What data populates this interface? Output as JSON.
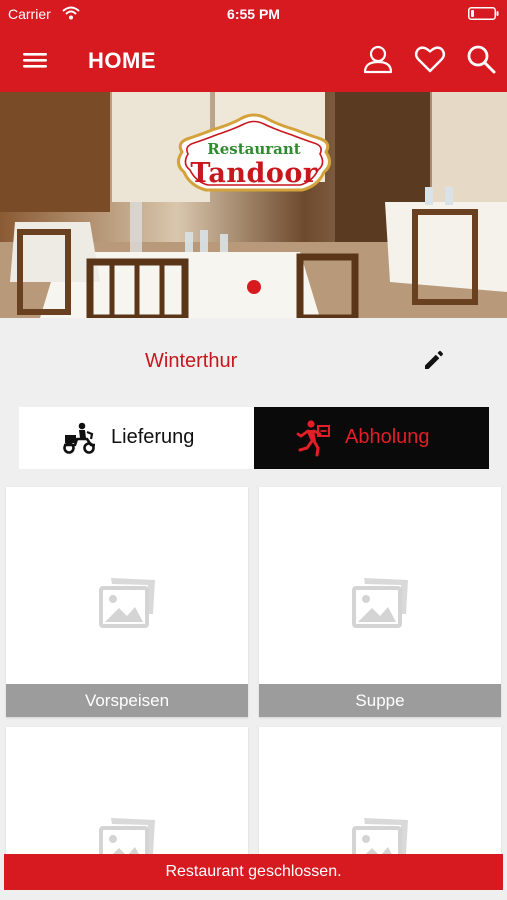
{
  "status_bar": {
    "carrier": "Carrier",
    "time": "6:55 PM"
  },
  "header": {
    "title": "HOME",
    "background_color": "#d71920",
    "icons": [
      "menu-icon",
      "user-icon",
      "heart-icon",
      "search-icon"
    ]
  },
  "hero": {
    "logo_line1": "Restaurant",
    "logo_line2": "Tandoor",
    "carousel_dot_color": "#d71920"
  },
  "location": {
    "city": "Winterthur",
    "edit_icon": "pencil-icon"
  },
  "order_mode": {
    "options": [
      {
        "label": "Lieferung",
        "icon": "scooter-icon",
        "selected": false
      },
      {
        "label": "Abholung",
        "icon": "runner-icon",
        "selected": true
      }
    ],
    "selected_color": "#e41e26"
  },
  "categories": [
    {
      "label": "Vorspeisen",
      "icon": "image-placeholder-icon"
    },
    {
      "label": "Suppe",
      "icon": "image-placeholder-icon"
    },
    {
      "label": "",
      "icon": "image-placeholder-icon"
    },
    {
      "label": "",
      "icon": "image-placeholder-icon"
    }
  ],
  "banner": {
    "text": "Restaurant geschlossen.",
    "color": "#d71920"
  }
}
